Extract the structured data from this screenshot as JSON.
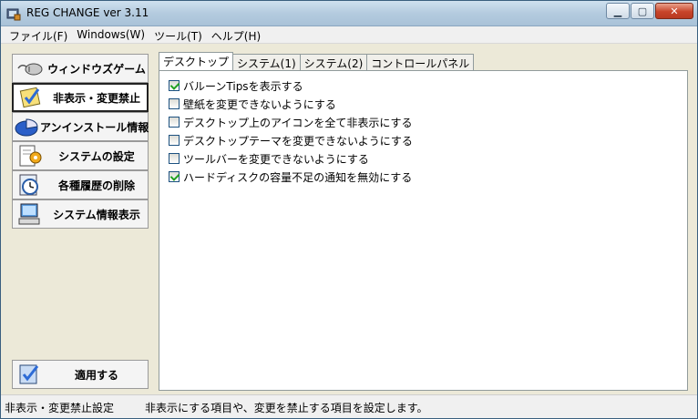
{
  "window": {
    "title": "REG CHANGE ver 3.11"
  },
  "menu": [
    "ファイル(F)",
    "Windows(W)",
    "ツール(T)",
    "ヘルプ(H)"
  ],
  "nav": [
    {
      "label": "ウィンドウズゲーム",
      "icon": "mouse-icon"
    },
    {
      "label": "非表示・変更禁止",
      "icon": "checklist-icon",
      "active": true
    },
    {
      "label": "アンインストール情報",
      "icon": "pie-chart-icon"
    },
    {
      "label": "システムの設定",
      "icon": "gear-document-icon"
    },
    {
      "label": "各種履歴の削除",
      "icon": "clock-icon"
    },
    {
      "label": "システム情報表示",
      "icon": "computer-icon"
    }
  ],
  "apply_button": {
    "label": "適用する",
    "icon": "apply-checklist-icon"
  },
  "tabs": [
    "デスクトップ",
    "システム(1)",
    "システム(2)",
    "コントロールパネル"
  ],
  "active_tab": "デスクトップ",
  "options": [
    {
      "label": "バルーンTipsを表示する",
      "checked": true
    },
    {
      "label": "壁紙を変更できないようにする",
      "checked": false
    },
    {
      "label": "デスクトップ上のアイコンを全て非表示にする",
      "checked": false
    },
    {
      "label": "デスクトップテーマを変更できないようにする",
      "checked": false
    },
    {
      "label": "ツールバーを変更できないようにする",
      "checked": false
    },
    {
      "label": "ハードディスクの容量不足の通知を無効にする",
      "checked": true
    }
  ],
  "status": {
    "left": "非表示・変更禁止設定",
    "right": "非表示にする項目や、変更を禁止する項目を設定します。"
  },
  "colors": {
    "accent_check": "#21a121",
    "titlebar": "#b4cbdf",
    "close_button": "#c8452b"
  }
}
